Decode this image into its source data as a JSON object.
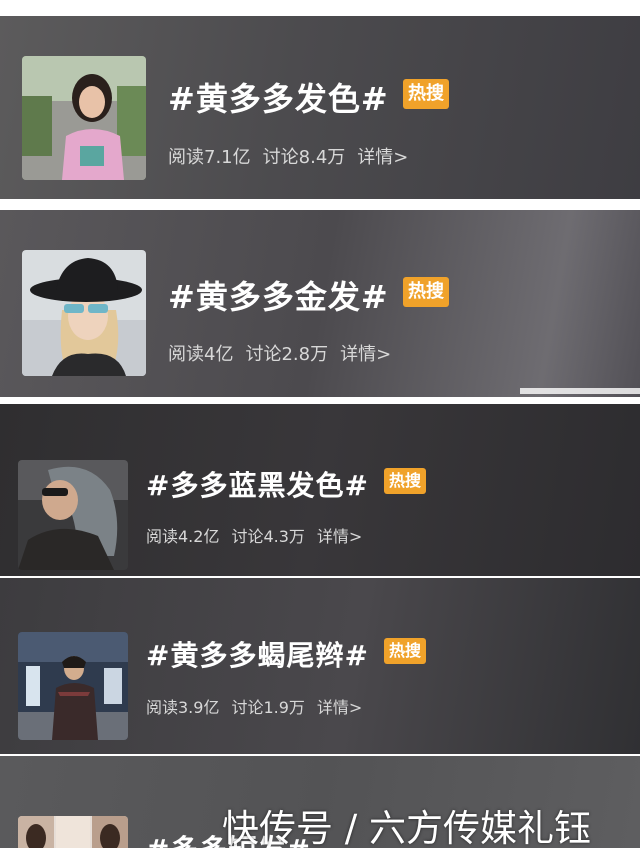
{
  "topics": [
    {
      "title": "#黄多多发色#",
      "badge": "热搜",
      "reads": "阅读7.1亿",
      "discussions": "讨论8.4万",
      "details": "详情>"
    },
    {
      "title": "#黄多多金发#",
      "badge": "热搜",
      "reads": "阅读4亿",
      "discussions": "讨论2.8万",
      "details": "详情>"
    },
    {
      "title": "#多多蓝黑发色#",
      "badge": "热搜",
      "reads": "阅读4.2亿",
      "discussions": "讨论4.3万",
      "details": "详情>"
    },
    {
      "title": "#黄多多蝎尾辫#",
      "badge": "热搜",
      "reads": "阅读3.9亿",
      "discussions": "讨论1.9万",
      "details": "详情>"
    },
    {
      "title": "#多多短发#"
    }
  ],
  "watermark": "快传号 / 六方传媒礼钰",
  "colors": {
    "badge": "#f0a22a",
    "title": "#ffffff",
    "meta": "#d8d8d8"
  }
}
